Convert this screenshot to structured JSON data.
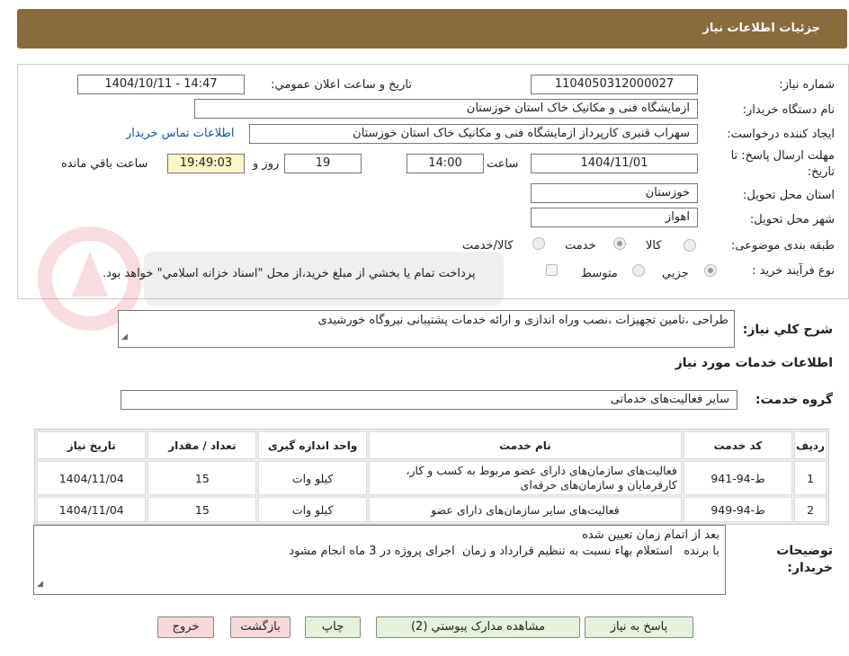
{
  "header": {
    "title": "جزئیات اطلاعات نیاز"
  },
  "form": {
    "need_number_label": "شماره نياز:",
    "need_number": "1104050312000027",
    "announce_label": "تاريخ و ساعت اعلان عمومي:",
    "announce_value": "1404/10/11 - 14:47",
    "buyer_org_label": "نام دستگاه خريدار:",
    "buyer_org": "ازمایشگاه فنی و مکانیک خاک استان خوزستان",
    "requester_label": "ايجاد کننده درخواست:",
    "requester": "سهراب قنبری کارپرداز ازمایشگاه فنی و مکانیک خاک استان خوزستان",
    "contact_link": "اطلاعات تماس خريدار",
    "deadline_label": "مهلت ارسال پاسخ: تا تاریخ:",
    "deadline_date": "1404/11/01",
    "time_label": "ساعت",
    "deadline_time": "14:00",
    "days": "19",
    "days_label": "روز و",
    "remaining_time": "19:49:03",
    "remaining_label": "ساعت باقي مانده",
    "province_label": "استان محل تحويل:",
    "province": "خوزستان",
    "city_label": "شهر محل تحويل:",
    "city": "اهواز",
    "category_label": "طبقه بندی موضوعی:",
    "category_options": [
      "کالا",
      "خدمت",
      "کالا/خدمت"
    ],
    "category_selected": "خدمت",
    "purchase_type_label": "نوع فرآيند خريد :",
    "purchase_options": [
      "جزيي",
      "متوسط"
    ],
    "purchase_selected": "جزيي",
    "payment_note": "پرداخت تمام يا بخشي از مبلغ خريد،از محل \"اسناد خزانه اسلامي\" خواهد بود."
  },
  "summary": {
    "label": "شرح کلي نياز:",
    "text": "طراحی ،تامین تجهیزات ،نصب وراه اندازی و ارائه خدمات پشتیبانی نیروگاه خورشیدی"
  },
  "services": {
    "section_title": "اطلاعات خدمات مورد نياز",
    "group_label": "گروه خدمت:",
    "group_value": "سایر فعالیت‌های خدماتی",
    "columns": [
      "رديف",
      "کد خدمت",
      "نام خدمت",
      "واحد اندازه گيری",
      "تعداد / مقدار",
      "تاريخ نياز"
    ],
    "rows": [
      {
        "index": "1",
        "code": "ط-94-941",
        "name": "فعالیت‌های سازمان‌های دارای عضو مربوط به کسب و کار، کارفرمایان و سازمان‌های حرفه‌ای",
        "unit": "کیلو وات",
        "qty": "15",
        "date": "1404/11/04"
      },
      {
        "index": "2",
        "code": "ط-94-949",
        "name": "فعالیت‌های سایر سازمان‌های دارای عضو",
        "unit": "کیلو وات",
        "qty": "15",
        "date": "1404/11/04"
      }
    ]
  },
  "notes": {
    "label": "توضيحات خريدار:",
    "line1": "بعد از اتمام زمان تعیین شده",
    "line2": "با برنده   استعلام بهاء نسبت به تنظیم قرارداد و زمان  اجرای پروژه در 3 ماه انجام مشود"
  },
  "buttons": {
    "respond": "پاسخ به نياز",
    "attachments": "مشاهده مدارک پيوستي (2)",
    "print": "چاپ",
    "back": "بازگشت",
    "exit": "خروج"
  },
  "colors": {
    "header_bg": "#8a6b3d",
    "link": "#1a4fb5",
    "button_green": "#e4f2dc",
    "button_red": "#f7d9da",
    "remaining_bg": "#fdf6c8"
  }
}
